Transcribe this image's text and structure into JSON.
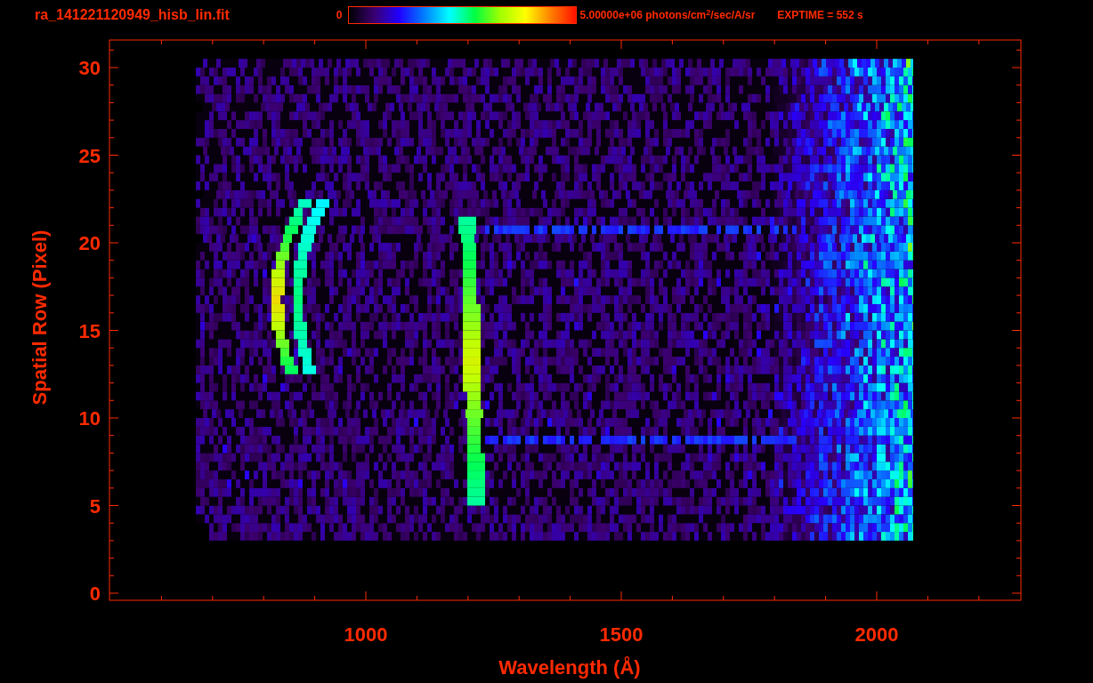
{
  "header": {
    "filename": "ra_141221120949_hisb_lin.fit",
    "colorbar_min": "0",
    "colorbar_max": "5.00000e+06 photons/cm$^{2}$/sec/A/sr",
    "exptime": "EXPTIME = 552 s"
  },
  "plot": {
    "xlabel": "Wavelength (Å)",
    "ylabel": "Spatial Row (Pixel)",
    "xticks": [
      "1000",
      "1500",
      "2000"
    ],
    "yticks": [
      "30",
      "25",
      "20",
      "15",
      "10",
      "5",
      "0"
    ]
  }
}
